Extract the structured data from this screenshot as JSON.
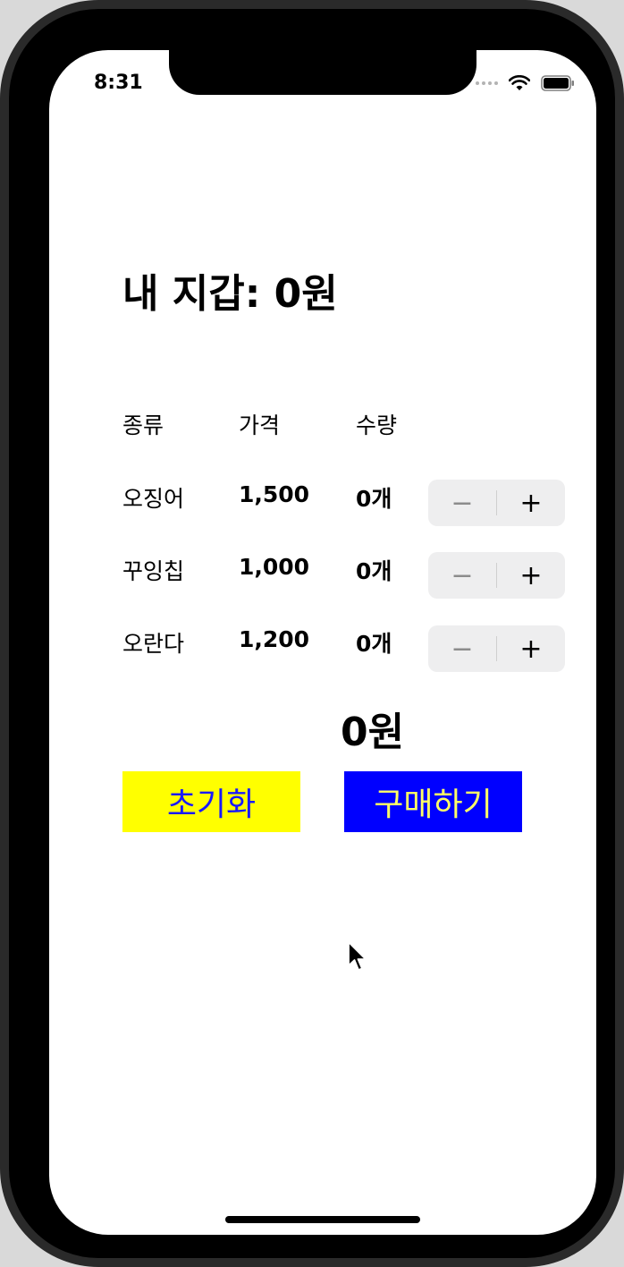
{
  "status_bar": {
    "time": "8:31"
  },
  "wallet": {
    "text": "내 지갑: 0원"
  },
  "table": {
    "headers": [
      "종류",
      "가격",
      "수량"
    ],
    "rows": [
      {
        "name": "오징어",
        "price": "1,500",
        "qty": "0개"
      },
      {
        "name": "꾸잉칩",
        "price": "1,000",
        "qty": "0개"
      },
      {
        "name": "오란다",
        "price": "1,200",
        "qty": "0개"
      }
    ]
  },
  "stepper": {
    "minus": "−",
    "plus": "+"
  },
  "total": {
    "text": "0원"
  },
  "buttons": {
    "reset": "초기화",
    "buy": "구매하기"
  },
  "colors": {
    "reset_bg": "#ffff00",
    "reset_text": "#1a1aff",
    "buy_bg": "#0000ff",
    "buy_text": "#ffff66"
  },
  "icons": [
    "signal-dots-icon",
    "wifi-icon",
    "battery-icon",
    "mouse-cursor-icon"
  ]
}
